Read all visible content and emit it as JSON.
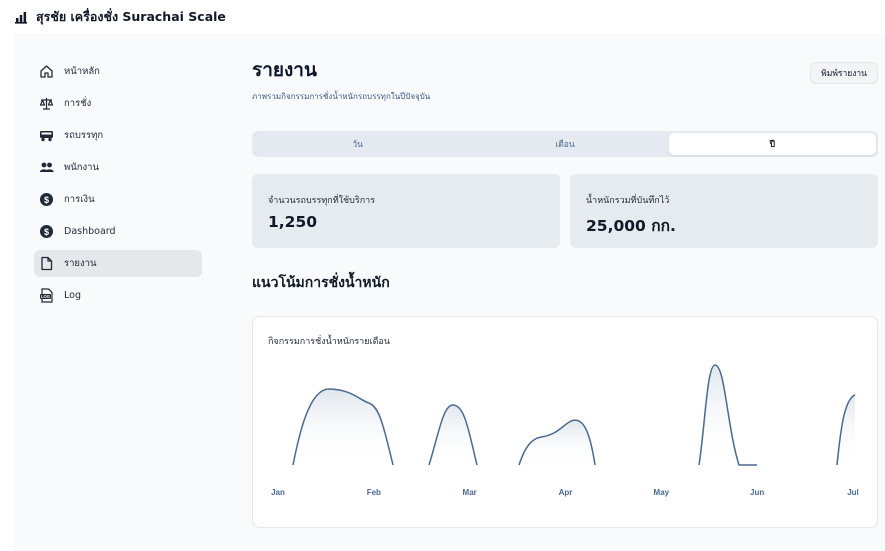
{
  "app": {
    "title": "สุรชัย เครื่องชั่ง Surachai Scale"
  },
  "sidebar": {
    "items": [
      {
        "label": "หน้าหลัก",
        "icon": "home-icon"
      },
      {
        "label": "การชั่ง",
        "icon": "scale-icon"
      },
      {
        "label": "รถบรรทุก",
        "icon": "truck-icon"
      },
      {
        "label": "พนักงาน",
        "icon": "users-icon"
      },
      {
        "label": "การเงิน",
        "icon": "dollar-icon"
      },
      {
        "label": "Dashboard",
        "icon": "dollar-icon"
      },
      {
        "label": "รายงาน",
        "icon": "file-icon",
        "active": true
      },
      {
        "label": "Log",
        "icon": "log-icon"
      }
    ]
  },
  "header": {
    "title": "รายงาน",
    "subtitle": "ภาพรวมกิจกรรมการชั่งน้ำหนักรถบรรทุกในปีปัจจุบัน",
    "print_label": "พิมพ์รายงาน"
  },
  "tabs": [
    {
      "label": "วัน"
    },
    {
      "label": "เดือน"
    },
    {
      "label": "ปี",
      "active": true
    }
  ],
  "stats": {
    "trucks": {
      "label": "จำนวนรถบรรทุกที่ใช้บริการ",
      "value": "1,250"
    },
    "weight": {
      "label": "น้ำหนักรวมที่บันทึกไว้",
      "value": "25,000 กก."
    }
  },
  "section": {
    "title": "แนวโน้มการชั่งน้ำหนัก"
  },
  "chart": {
    "title": "กิจกรรมการชั่งน้ำหนักรายเดือน"
  },
  "chart_data": {
    "type": "area",
    "categories": [
      "Jan",
      "Feb",
      "Mar",
      "Apr",
      "May",
      "Jun",
      "Jul"
    ],
    "line_color": "#4a6a91",
    "fill_color": "#e5e9ef",
    "grid": false
  },
  "colors": {
    "accent": "#4a6a91",
    "tab_background": "#e5eaf0",
    "card_background": "#e6ebf0"
  }
}
